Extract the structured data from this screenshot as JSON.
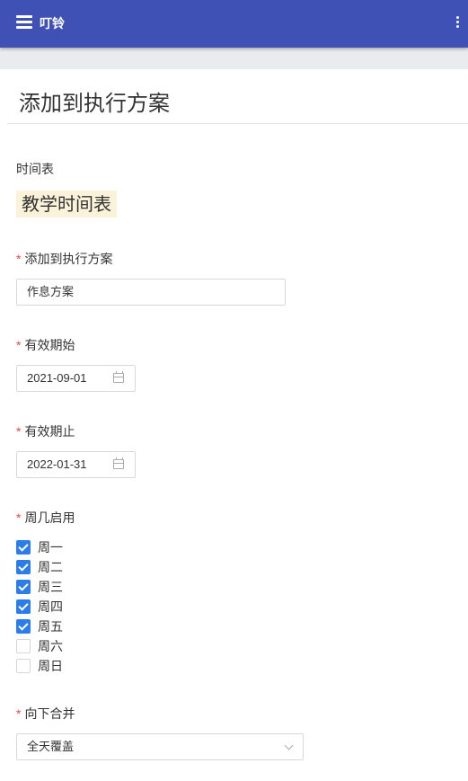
{
  "app_bar": {
    "title": "叮铃"
  },
  "page": {
    "title": "添加到执行方案"
  },
  "form": {
    "schedule_label": "时间表",
    "schedule_value": "教学时间表",
    "plan": {
      "label": "添加到执行方案",
      "value": "作息方案"
    },
    "start": {
      "label": "有效期始",
      "value": "2021-09-01"
    },
    "end": {
      "label": "有效期止",
      "value": "2022-01-31"
    },
    "weekdays": {
      "label": "周几启用",
      "items": [
        {
          "label": "周一",
          "checked": true
        },
        {
          "label": "周二",
          "checked": true
        },
        {
          "label": "周三",
          "checked": true
        },
        {
          "label": "周四",
          "checked": true
        },
        {
          "label": "周五",
          "checked": true
        },
        {
          "label": "周六",
          "checked": false
        },
        {
          "label": "周日",
          "checked": false
        }
      ]
    },
    "merge": {
      "label": "向下合并",
      "value": "全天覆盖"
    },
    "required_mark": "*"
  },
  "colors": {
    "app_bar": "#3f51b5",
    "checked": "#2b7de9",
    "required": "#e64a4a",
    "highlight": "#fbf3d9"
  }
}
